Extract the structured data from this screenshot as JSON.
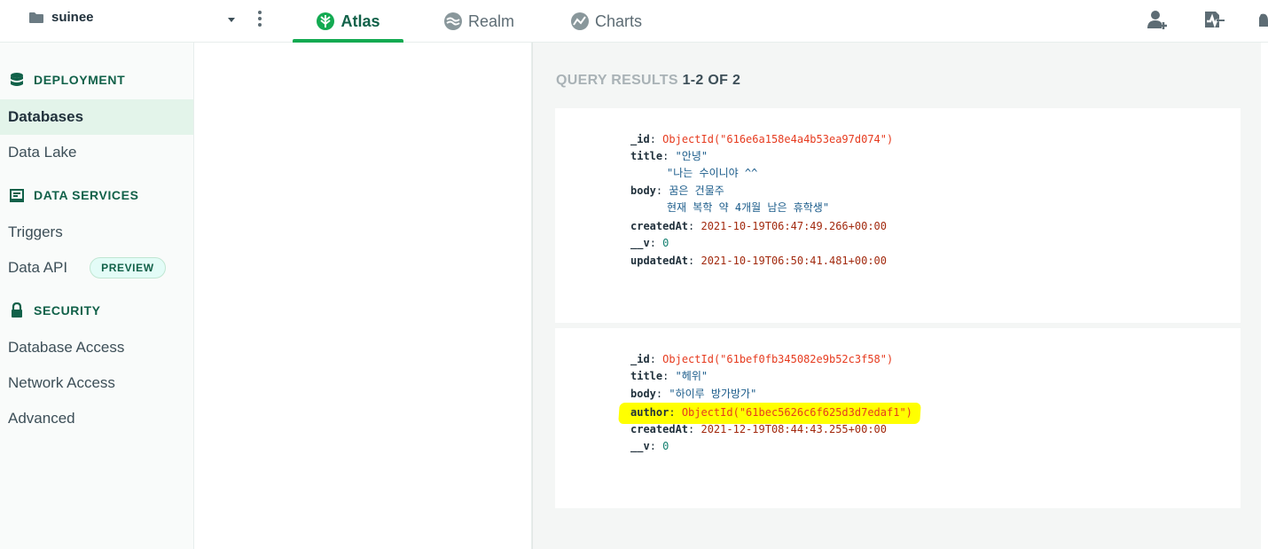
{
  "topbar": {
    "project_name": "suinee",
    "tabs": [
      {
        "label": "Atlas",
        "active": true
      },
      {
        "label": "Realm",
        "active": false
      },
      {
        "label": "Charts",
        "active": false
      }
    ]
  },
  "sidebar": {
    "sections": [
      {
        "title": "DEPLOYMENT",
        "icon": "database-stack-icon"
      },
      {
        "title": "DATA SERVICES",
        "icon": "data-services-icon"
      },
      {
        "title": "SECURITY",
        "icon": "lock-icon"
      }
    ],
    "items": [
      {
        "label": "Databases",
        "active": true
      },
      {
        "label": "Data Lake"
      },
      {
        "label": "Triggers"
      },
      {
        "label": "Data API",
        "badge": "PREVIEW"
      },
      {
        "label": "Database Access"
      },
      {
        "label": "Network Access"
      },
      {
        "label": "Advanced"
      }
    ]
  },
  "results": {
    "header_prefix": "QUERY RESULTS",
    "header_count": "1-2 OF 2",
    "documents": [
      {
        "id_key": "_id",
        "id_val": "ObjectId(\"616e6a158e4a4b53ea97d074\")",
        "title_key": "title",
        "title_val": "\"안녕\"",
        "body_key": "body",
        "body_line1": "\"나는 수이니야 ^^",
        "body_line2": "꿈은 건물주",
        "body_line3": "현재 복학 약 4개월 남은 휴학생\"",
        "created_key": "createdAt",
        "created_val": "2021-10-19T06:47:49.266+00:00",
        "v_key": "__v",
        "v_val": "0",
        "updated_key": "updatedAt",
        "updated_val": "2021-10-19T06:50:41.481+00:00"
      },
      {
        "id_key": "_id",
        "id_val": "ObjectId(\"61bef0fb345082e9b52c3f58\")",
        "title_key": "title",
        "title_val": "\"헤위\"",
        "body_key": "body",
        "body_val": "\"하이루 방가방가\"",
        "author_key": "author",
        "author_val": "ObjectId(\"61bec5626c6f625d3d7edaf1\")",
        "created_key": "createdAt",
        "created_val": "2021-12-19T08:44:43.255+00:00",
        "v_key": "__v",
        "v_val": "0"
      }
    ]
  },
  "colors": {
    "brand_green": "#13aa52",
    "oid": "#e63b1f",
    "highlight": "#ffff00"
  }
}
